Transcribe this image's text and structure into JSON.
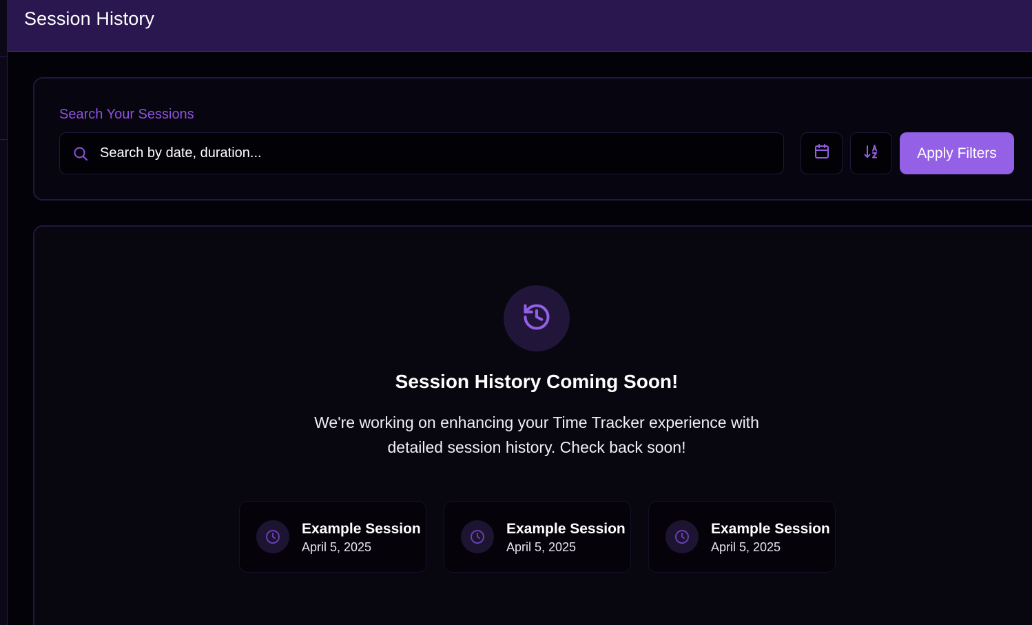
{
  "header": {
    "title": "Session History"
  },
  "search": {
    "title": "Search Your Sessions",
    "placeholder": "Search by date, duration...",
    "apply_label": "Apply Filters"
  },
  "content": {
    "heading": "Session History Coming Soon!",
    "message": "We're working on enhancing your Time Tracker experience with detailed session history. Check back soon!",
    "examples": [
      {
        "name": "Example Session",
        "date": "April 5, 2025"
      },
      {
        "name": "Example Session",
        "date": "April 5, 2025"
      },
      {
        "name": "Example Session",
        "date": "April 5, 2025"
      }
    ]
  },
  "icons": {
    "search": "search-icon",
    "calendar": "calendar-icon",
    "sort": "sort-alphabetical-icon",
    "history": "history-clock-icon",
    "clock": "clock-icon"
  },
  "colors": {
    "accent": "#9360e6",
    "header_bg": "#2b174f",
    "page_bg": "#030208",
    "search_label": "#8e52de"
  }
}
